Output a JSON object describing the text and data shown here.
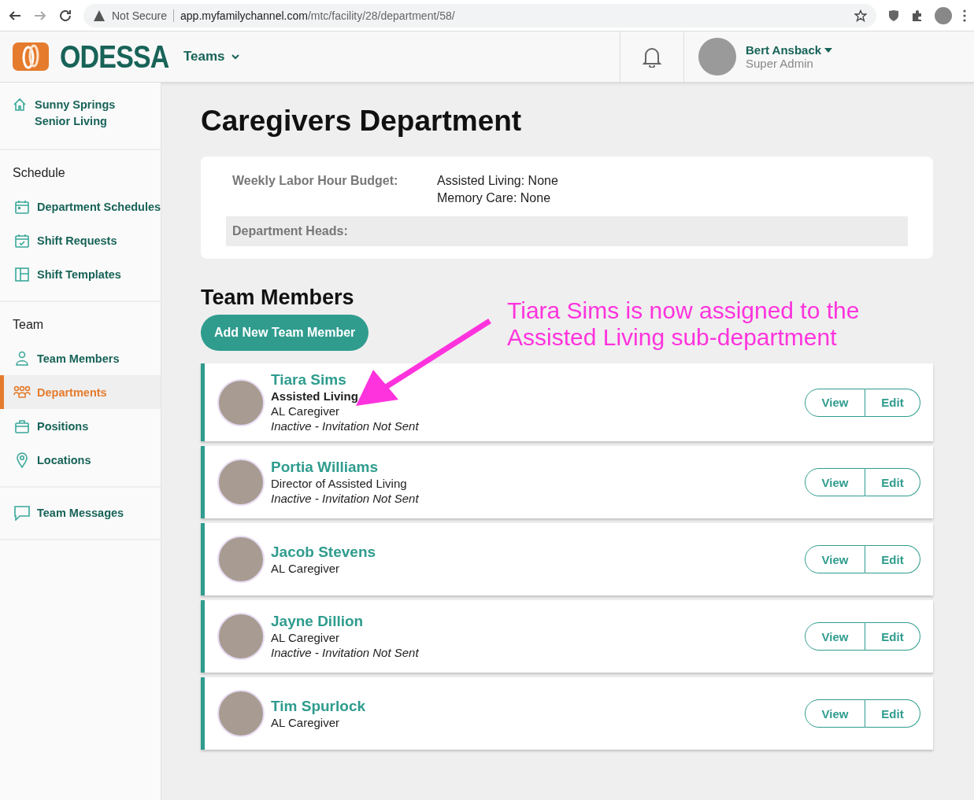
{
  "browser": {
    "security": "Not Secure",
    "url_host": "app.myfamilychannel.com",
    "url_path": "/mtc/facility/28/department/58/"
  },
  "header": {
    "logo": "ODESSA",
    "menu": "Teams",
    "user": {
      "name": "Bert Ansback",
      "role": "Super Admin"
    }
  },
  "sidebar": {
    "facility": "Sunny Springs Senior Living",
    "sections": [
      {
        "heading": "Schedule",
        "items": [
          {
            "label": "Department Schedules",
            "kind": "calendar",
            "selected": false
          },
          {
            "label": "Shift Requests",
            "kind": "request",
            "selected": false
          },
          {
            "label": "Shift Templates",
            "kind": "template",
            "selected": false
          }
        ]
      },
      {
        "heading": "Team",
        "items": [
          {
            "label": "Team Members",
            "kind": "member",
            "selected": false
          },
          {
            "label": "Departments",
            "kind": "department",
            "selected": true
          },
          {
            "label": "Positions",
            "kind": "position",
            "selected": false
          },
          {
            "label": "Locations",
            "kind": "location",
            "selected": false
          }
        ]
      },
      {
        "items": [
          {
            "label": "Team Messages",
            "kind": "message",
            "selected": false
          }
        ]
      }
    ]
  },
  "page": {
    "title": "Caregivers Department",
    "budget": {
      "label": "Weekly Labor Hour Budget:",
      "values": [
        "Assisted Living: None",
        "Memory Care: None"
      ]
    },
    "heads": {
      "label": "Department Heads:"
    },
    "members_title": "Team Members",
    "add_button": "Add New Team Member",
    "members": [
      {
        "name": "Tiara Sims",
        "department": "Assisted Living",
        "position": "AL Caregiver",
        "status": "Inactive - Invitation Not Sent",
        "view": "View",
        "edit": "Edit"
      },
      {
        "name": "Portia Williams",
        "position": "Director of Assisted Living",
        "status": "Inactive - Invitation Not Sent",
        "view": "View",
        "edit": "Edit"
      },
      {
        "name": "Jacob Stevens",
        "position": "AL Caregiver",
        "view": "View",
        "edit": "Edit"
      },
      {
        "name": "Jayne Dillion",
        "position": "AL Caregiver",
        "status": "Inactive - Invitation Not Sent",
        "view": "View",
        "edit": "Edit"
      },
      {
        "name": "Tim Spurlock",
        "position": "AL Caregiver",
        "view": "View",
        "edit": "Edit"
      }
    ]
  },
  "annotation": {
    "text": "Tiara Sims is now assigned to the Assisted Living sub-department"
  }
}
